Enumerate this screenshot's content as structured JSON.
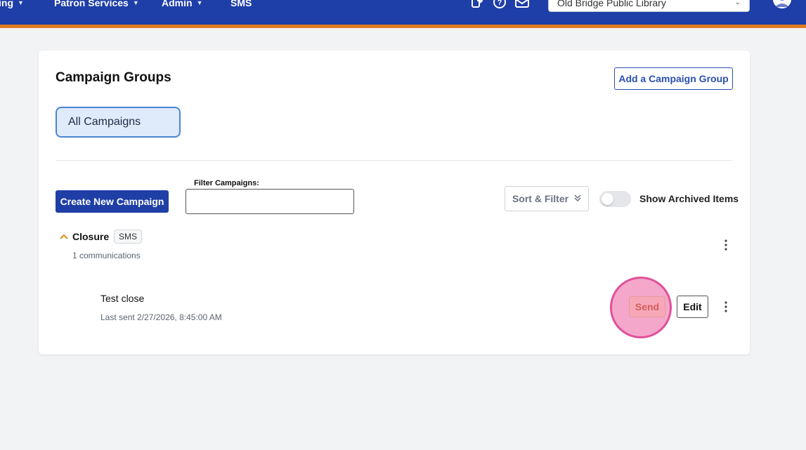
{
  "nav": {
    "items": [
      {
        "label": "ing"
      },
      {
        "label": "Patron Services"
      },
      {
        "label": "Admin"
      },
      {
        "label": "SMS"
      }
    ],
    "library_select": "Old Bridge Public Library",
    "colors": {
      "bar": "#1e3ea8",
      "accent": "#e07b22"
    }
  },
  "page": {
    "title": "Campaign Groups",
    "add_group_label": "Add a Campaign Group",
    "all_campaigns_label": "All Campaigns"
  },
  "toolbar": {
    "create_label": "Create New Campaign",
    "filter_label": "Filter Campaigns:",
    "filter_value": "",
    "sort_label": "Sort & Filter",
    "archived_label": "Show Archived Items",
    "archived_on": false
  },
  "groups": [
    {
      "name": "Closure",
      "badge": "SMS",
      "count_text": "1 communications",
      "campaigns": [
        {
          "name": "Test close",
          "last_sent": "Last sent 2/27/2026, 8:45:00 AM",
          "send_label": "Send",
          "edit_label": "Edit"
        }
      ]
    }
  ]
}
